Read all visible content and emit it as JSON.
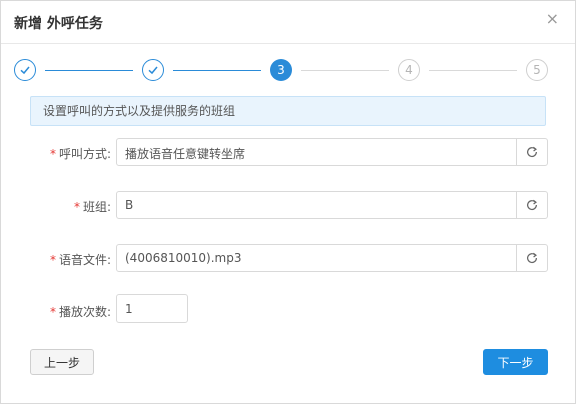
{
  "dialog": {
    "title": "新增 外呼任务",
    "close_glyph": "×"
  },
  "steps": [
    {
      "status": "done",
      "label": "",
      "icon": "check-icon"
    },
    {
      "status": "done",
      "label": "",
      "icon": "check-icon"
    },
    {
      "status": "active",
      "label": "3"
    },
    {
      "status": "todo",
      "label": "4"
    },
    {
      "status": "todo",
      "label": "5"
    }
  ],
  "banner": {
    "text": "设置呼叫的方式以及提供服务的班组"
  },
  "form": {
    "required_mark": "*",
    "call_mode": {
      "label": "呼叫方式:",
      "value": "播放语音任意键转坐席"
    },
    "team": {
      "label": "班组:",
      "value": "B"
    },
    "voice_file": {
      "label": "语音文件:",
      "value": "(4006810010).mp3"
    },
    "play_count": {
      "label": "播放次数:",
      "value": "1"
    }
  },
  "buttons": {
    "prev": "上一步",
    "next": "下一步"
  },
  "colors": {
    "accent": "#2a8bd8",
    "primary_button": "#1e8de0",
    "required": "#e53935",
    "banner_bg": "#e9f4fd"
  }
}
